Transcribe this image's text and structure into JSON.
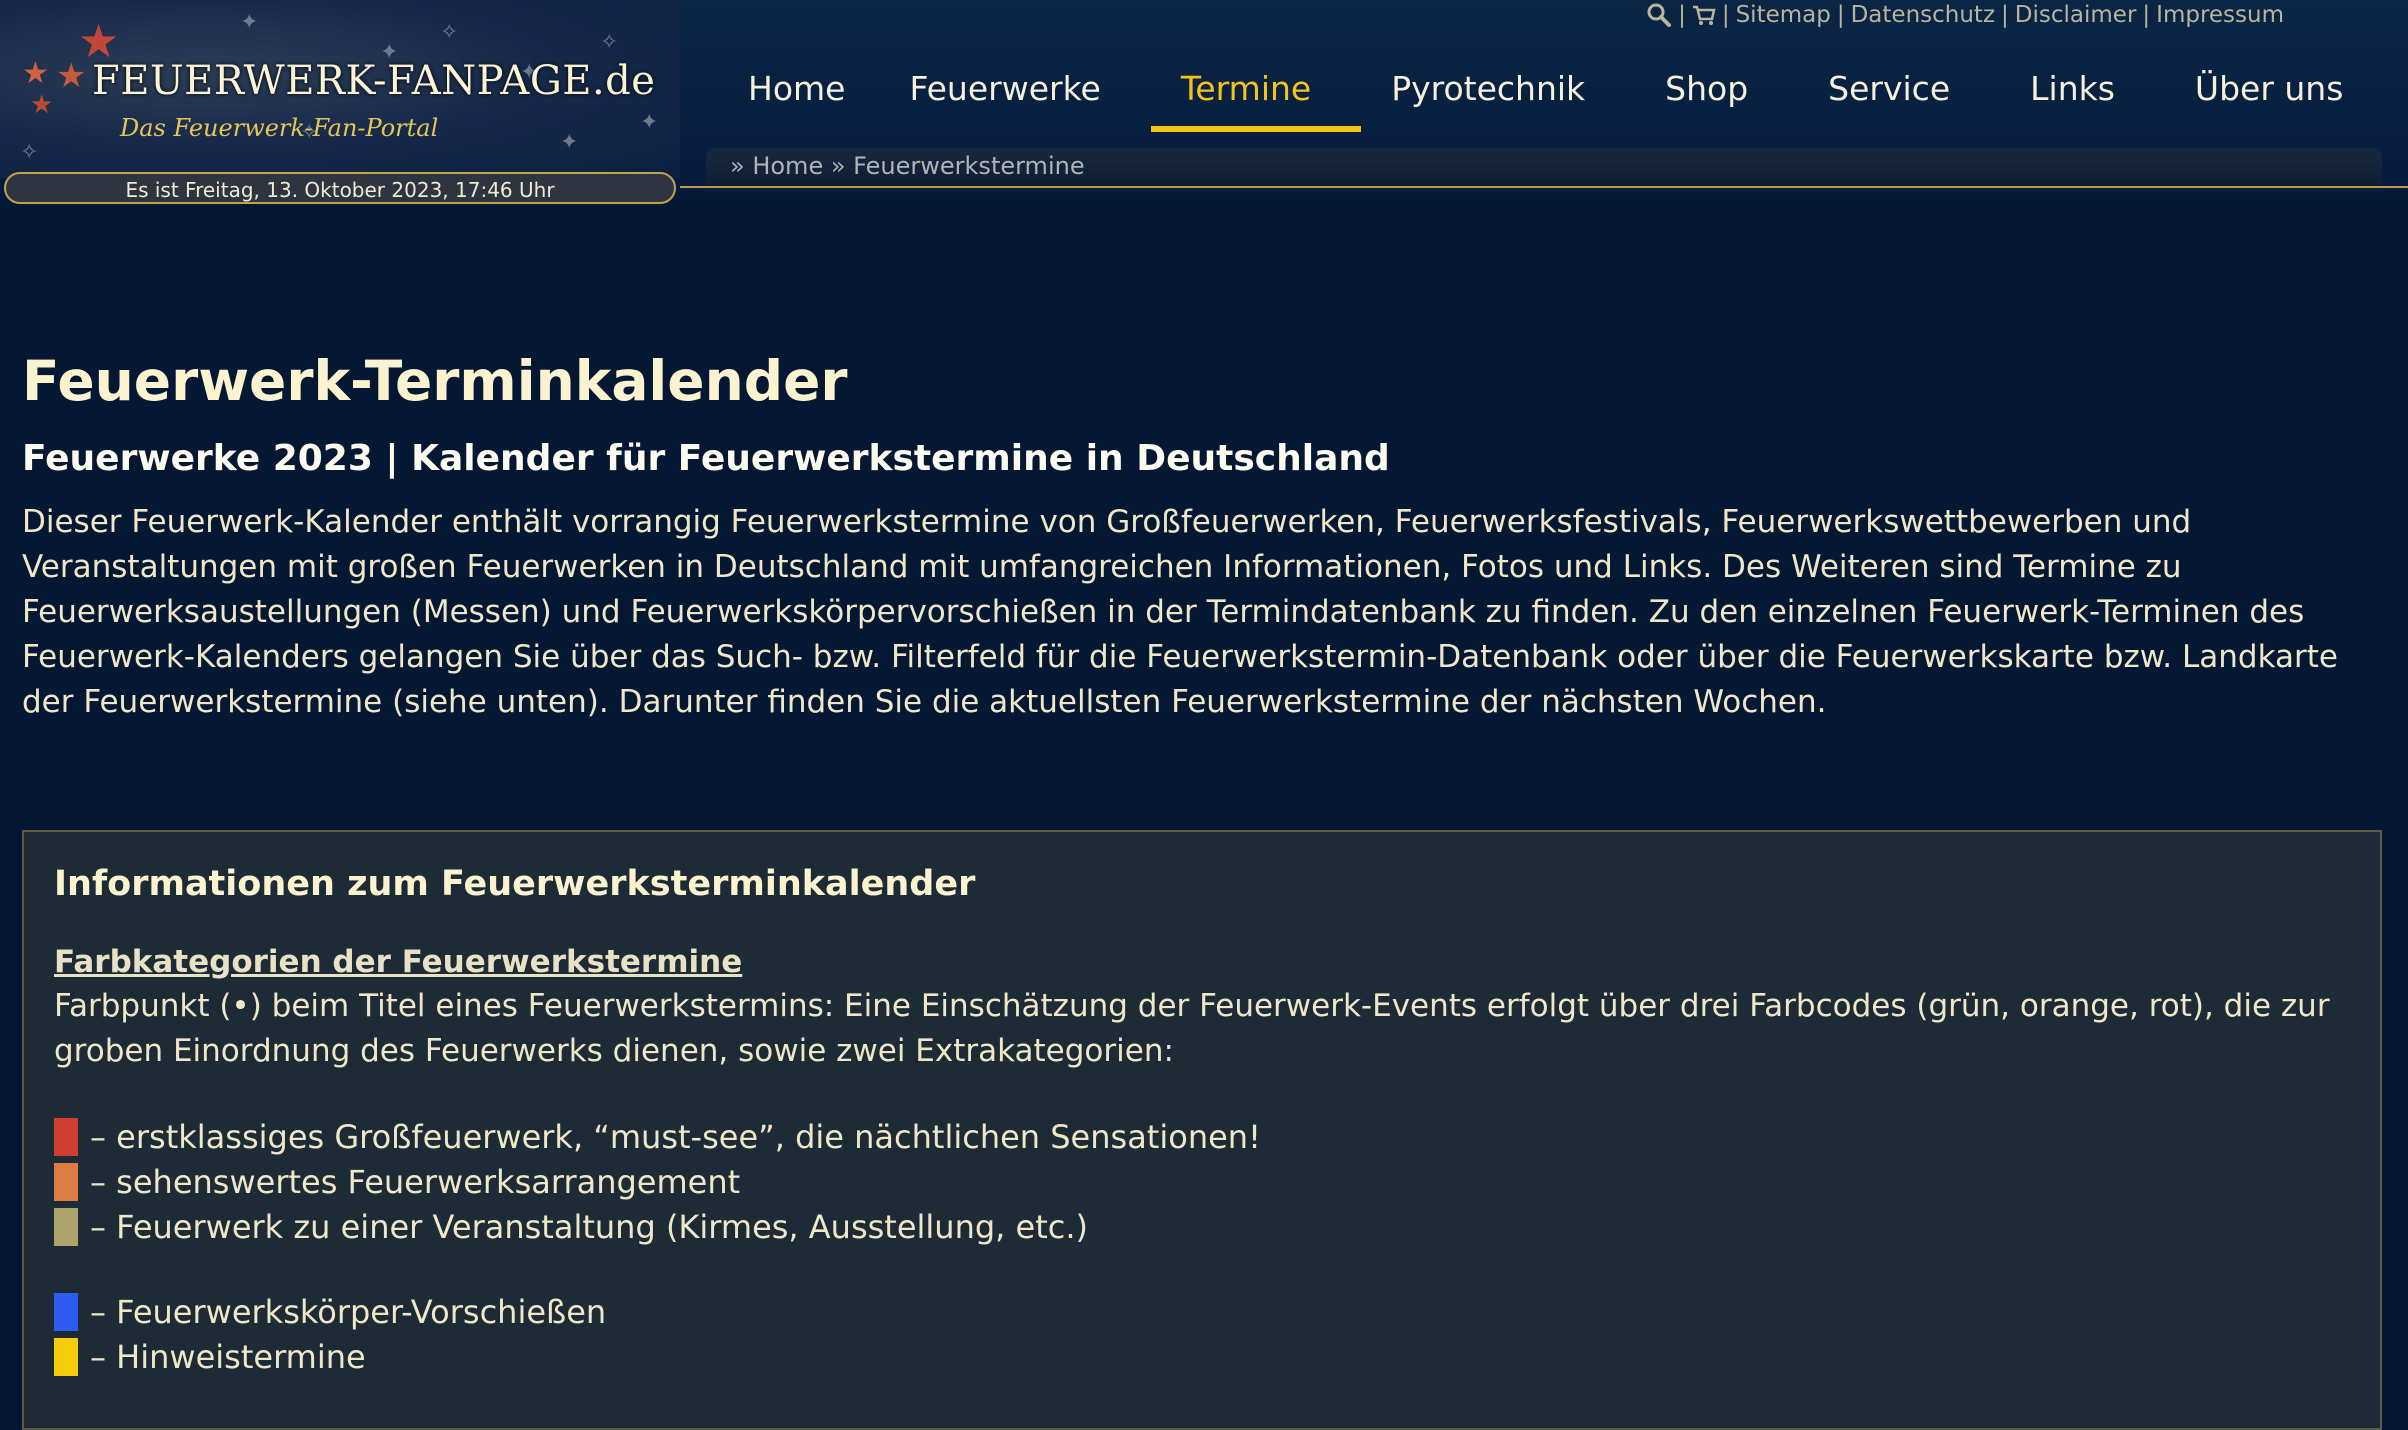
{
  "site": {
    "logo_title": "FEUERWERK-FANPAGE.de",
    "logo_subtitle": "Das Feuerwerk-Fan-Portal",
    "date_text": "Es ist Freitag, 13. Oktober 2023, 17:46 Uhr"
  },
  "toplinks": {
    "sep": "|",
    "sitemap": "Sitemap",
    "datenschutz": "Datenschutz",
    "disclaimer": "Disclaimer",
    "impressum": "Impressum"
  },
  "nav": {
    "items": [
      "Home",
      "Feuerwerke",
      "Termine",
      "Pyrotechnik",
      "Shop",
      "Service",
      "Links",
      "Über uns"
    ],
    "active": "Termine"
  },
  "breadcrumb": {
    "prefix": "»",
    "home": "Home",
    "current": "Feuerwerkstermine"
  },
  "content": {
    "title": "Feuerwerk-Terminkalender",
    "subtitle": "Feuerwerke 2023 | Kalender für Feuerwerkstermine in Deutschland",
    "intro": "Dieser Feuerwerk-Kalender enthält vorrangig Feuerwerkstermine von Großfeuerwerken, Feuerwerksfestivals, Feuerwerkswettbewerben und Veranstaltungen mit großen Feuerwerken in Deutschland mit umfangreichen Informationen, Fotos und Links. Des Weiteren sind Termine zu Feuerwerksaustellungen (Messen) und Feuerwerkskörpervorschießen in der Termindatenbank zu finden. Zu den einzelnen Feuerwerk-Terminen des Feuerwerk-Kalenders gelangen Sie über das Such- bzw. Filterfeld für die Feuerwerkstermin-Datenbank oder über die Feuerwerkskarte bzw. Landkarte der Feuerwerkstermine (siehe unten). Darunter finden Sie die aktuellsten Feuerwerkstermine der nächsten Wochen."
  },
  "infobox": {
    "title": "Informationen zum Feuerwerksterminkalender",
    "section_title": "Farbkategorien der Feuerwerkstermine",
    "description": "Farbpunkt (•) beim Titel eines Feuerwerkstermins: Eine Einschätzung der Feuerwerk-Events erfolgt über drei Farbcodes (grün, orange, rot), die zur groben Einordnung des Feuerwerks dienen, sowie zwei Extrakategorien:",
    "legend_main": [
      {
        "color": "#cf3e30",
        "label": "– erstklassiges Großfeuerwerk, “must-see”, die nächtlichen Sensationen!"
      },
      {
        "color": "#de7c45",
        "label": "– sehenswertes Feuerwerksarrangement"
      },
      {
        "color": "#aca36a",
        "label": "– Feuerwerk zu einer Veranstaltung (Kirmes, Ausstellung, etc.)"
      }
    ],
    "legend_extra": [
      {
        "color": "#2f5cf0",
        "label": "– Feuerwerkskörper-Vorschießen"
      },
      {
        "color": "#f5cc0c",
        "label": "– Hinweistermine"
      }
    ]
  }
}
